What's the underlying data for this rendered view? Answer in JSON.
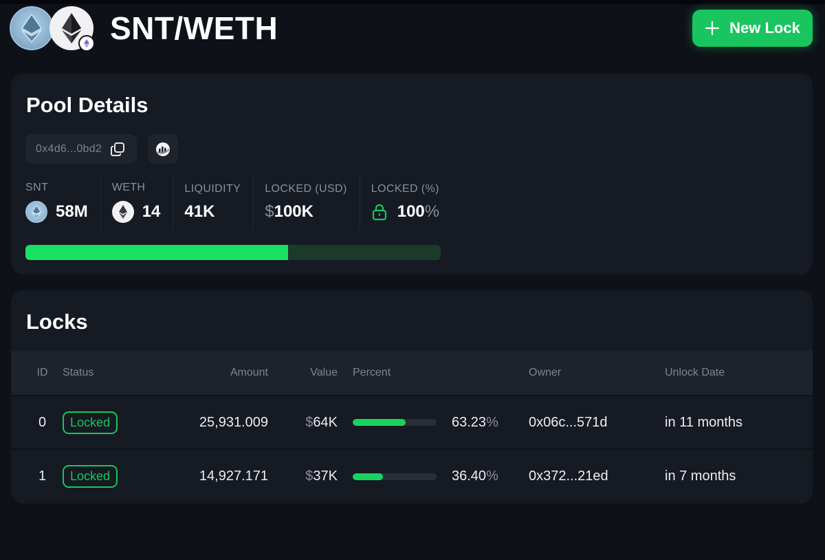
{
  "header": {
    "title": "SNT/WETH",
    "new_lock_label": "New Lock"
  },
  "pool": {
    "title": "Pool Details",
    "address": "0x4d6...0bd2",
    "stats": {
      "snt": {
        "label": "SNT",
        "value": "58M"
      },
      "weth": {
        "label": "WETH",
        "value": "14"
      },
      "liquidity": {
        "label": "LIQUIDITY",
        "value": "41K"
      },
      "locked_usd": {
        "label": "LOCKED (USD)",
        "prefix": "$",
        "value": "100K"
      },
      "locked_pct": {
        "label": "LOCKED (%)",
        "value": "100",
        "suffix": "%"
      }
    },
    "bar_fill_percent": 63.23
  },
  "locks": {
    "title": "Locks",
    "columns": [
      "ID",
      "Status",
      "Amount",
      "Value",
      "Percent",
      "Owner",
      "Unlock Date"
    ],
    "rows": [
      {
        "id": "0",
        "status": "Locked",
        "amount": "25,931.009",
        "value_prefix": "$",
        "value": "64K",
        "percent": 63.23,
        "percent_num": "63.23",
        "percent_suffix": "%",
        "owner": "0x06c...571d",
        "unlock": "in 11 months"
      },
      {
        "id": "1",
        "status": "Locked",
        "amount": "14,927.171",
        "value_prefix": "$",
        "value": "37K",
        "percent": 36.4,
        "percent_num": "36.40",
        "percent_suffix": "%",
        "owner": "0x372...21ed",
        "unlock": "in 7 months"
      }
    ]
  },
  "colors": {
    "accent": "#19c55f",
    "background": "#0e1118",
    "card": "#161a22"
  },
  "icons": {
    "snt_token": "snt-token-icon",
    "weth_token": "eth-token-icon",
    "chain": "ethereum-chain-icon",
    "plus": "plus-icon",
    "copy": "copy-icon",
    "chart": "chart-icon",
    "lock": "lock-icon"
  }
}
